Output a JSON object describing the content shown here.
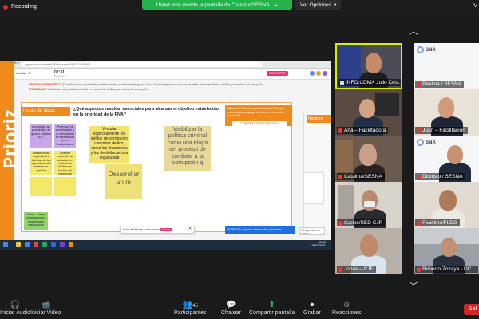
{
  "topbar": {
    "recording": "Recording",
    "banner": "Usted está viendo la pantalla de Catalina/SESNA",
    "view_options": "Ver Opciones",
    "right_glyph": "V"
  },
  "shared": {
    "vertical_text": "Prioriz",
    "browser_tab": "rt 9",
    "url": "app.mural.co/t/sesna8388/m/sesna8388/1614088911...",
    "mural_left": "rioridad ▼",
    "mural_title": "02:31",
    "mural_sub": "Sin título",
    "share_label": "COMPARTIR",
    "objective1_label": "OBJETIVO ESPECÍFICO 2",
    "objective1_text": "Fortalecer las capacidades institucionales para el desahogo de casos de investigación y sanción de faltas administrativas y delitos por hechos de corrupción.",
    "objective2_label": "PRIORIDAD 7",
    "objective2_text": "Establecer una política criminal en materia de delitos por hechos de corrupción.",
    "lluvia": "Lluvia de ideas",
    "question": "¿Qué aspectos resultan esenciales para alcanzar el objetivo establecido en la prioridad de la PNA?",
    "como_title": "Cómo:",
    "como_text": "La facilitador pueden ajustar el tiempo necesario para agregar las ideas en sus notas personales.",
    "timer": "COMIENZA CON 5 MINUTOS",
    "nucleos": "Nucleos",
    "notes": {
      "n1": "Investigar con perspectiva de género. México A.C.",
      "n2": "Promover la coordinación y el intercambio de información entre instituciones",
      "n3": "Fortalecer las capacidades técnicas de los operadores del sistema de justicia",
      "n4": "Generar protocolos de actuación en materia de delitos por hechos de corrupción",
      "n5": "Vincular explícitamente los delitos de corrupción con otros delitos, como los financieros y los de delincuencia organizada",
      "n6": "Visibilizar la política criminal como una etapa del proceso de combate a la corrupción q",
      "n7": "Desarrollar un m",
      "n8": "Orden - mayor independencia y coordinación institucional"
    },
    "toolbar_text": "Vista de Mural y colaboración",
    "toolbar_btn": "Unirse",
    "ayuda": "INGRESAR: Aprende a hacer clics y acciones",
    "config": "Configuración de acceso",
    "clock_time": "13:32",
    "clock_date": "26/02/2021"
  },
  "participants": [
    {
      "name": "INFO.CDMX Julio Cés...",
      "muted": false
    },
    {
      "name": "Paulina / SESNA",
      "muted": true
    },
    {
      "name": "Ana – Facilitadora",
      "muted": true
    },
    {
      "name": "Juan – Facilitación",
      "muted": true
    },
    {
      "name": "Catalina/SESNA",
      "muted": true
    },
    {
      "name": "Dionisio / SESNA",
      "muted": true
    },
    {
      "name": "Carlos/SED CJF",
      "muted": true
    },
    {
      "name": "Faustino/FLDG",
      "muted": true
    },
    {
      "name": "Jonas – CJF",
      "muted": true
    },
    {
      "name": "Roberto Zozaya - UC...",
      "muted": true
    }
  ],
  "sna_text": "SNA",
  "zoombar": {
    "audio": "Iniciar Audio",
    "video": "Iniciar Video",
    "participants": "Participantes",
    "participants_count": "45",
    "chat": "Chatear",
    "share": "Compartir pantalla",
    "record": "Grabar",
    "reactions": "Reacciones",
    "leave": "Sal"
  }
}
